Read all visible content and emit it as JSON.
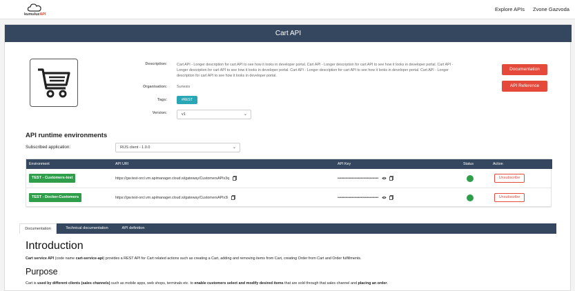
{
  "topnav": {
    "logo_text": "kumuluz",
    "logo_api": "API",
    "explore_label": "Explore APIs",
    "user_label": "Zvone Gazvoda"
  },
  "page": {
    "title": "Cart API"
  },
  "details": {
    "description_label": "Description:",
    "description": "Cart API - Longer description for cart API to see how it looks in developer portal. Cart API - Longer description for cart API to see how it looks in developer portal. Cart API - Longer description for cart API to see how it looks in developer portal. Cart API - Longer description for cart API to see how it looks in developer portal. Cart API - Longer description for cart API to see how it looks in developer portal.",
    "organisation_label": "Organisation:",
    "organisation": "Sunesis",
    "tags_label": "Tags:",
    "tag": "#REST",
    "version_label": "Version:",
    "version": "v1"
  },
  "buttons": {
    "documentation": "Documentation",
    "api_reference": "API Reference"
  },
  "environments": {
    "heading": "API runtime environments",
    "subscribed_label": "Subscribed application:",
    "subscribed_value": "RIJS client - 1.0.0",
    "columns": [
      "Environment",
      "API URI",
      "API Key",
      "Status",
      "Action"
    ],
    "rows": [
      {
        "environment": "TEST - Customers-test",
        "uri": "https://gw.test-orcl.vm.apimanager.cloud.si/gateway/CustomersAPIv3q",
        "key": "••••••••••••••••••••••••••••••••",
        "action": "Unsubscribe"
      },
      {
        "environment": "TEST - Docker-Customers",
        "uri": "https://gw.test-orcl.vm.apimanager.cloud.si/gateway/CustomersAPIv3i",
        "key": "••••••••••••••••••••••••••••••••",
        "action": "Unsubscribe"
      }
    ]
  },
  "tabs": [
    "Documentation",
    "Technical documentation",
    "API definition"
  ],
  "doc": {
    "intro_heading": "Introduction",
    "intro_bold1": "Cart service API",
    "intro_t1": " (code name ",
    "intro_bold2": "cart-service-api",
    "intro_t2": ") provides a REST API for Cart related actions such as creating a Cart, adding and removing items from Cart, creating Order from Cart and Order fulfillments.",
    "purpose_heading": "Purpose",
    "purpose_t1": "Cart is ",
    "purpose_bold1": "used by different clients (sales channels)",
    "purpose_t2": " such as mobile apps, web shops, terminals etc. to ",
    "purpose_bold2": "enable customers select and modify desired items",
    "purpose_t3": " that are sold through that sales channel and ",
    "purpose_bold3": "placing an order",
    "purpose_t4": "."
  },
  "colors": {
    "header": "#34475f",
    "accent_red": "#e4493a",
    "tag_teal": "#2aa7b5",
    "status_green": "#2e9e4a"
  }
}
